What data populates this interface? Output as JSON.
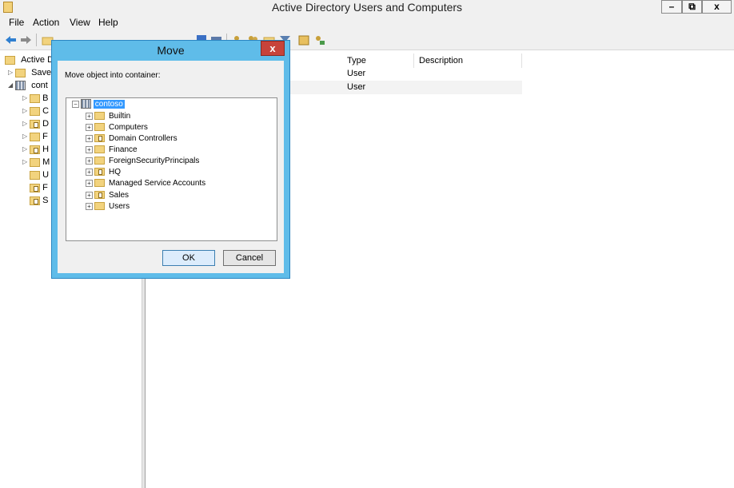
{
  "window": {
    "title": "Active Directory Users and Computers",
    "minimize": "–",
    "restore": "⧉",
    "close": "x"
  },
  "menu": [
    "File",
    "Action",
    "View",
    "Help"
  ],
  "left_tree": {
    "root": "Active D",
    "saved": "Save",
    "domain": "cont",
    "children": [
      "B",
      "C",
      "D",
      "F",
      "H",
      "M",
      "U",
      "F",
      "S"
    ]
  },
  "list": {
    "columns": [
      "Type",
      "Description"
    ],
    "rows": [
      {
        "type": "User",
        "description": ""
      },
      {
        "type": "User",
        "description": ""
      }
    ]
  },
  "dialog": {
    "title": "Move",
    "close": "x",
    "label": "Move object into container:",
    "tree_root": "contoso",
    "containers": [
      {
        "name": "Builtin",
        "ou": false
      },
      {
        "name": "Computers",
        "ou": false
      },
      {
        "name": "Domain Controllers",
        "ou": true
      },
      {
        "name": "Finance",
        "ou": false
      },
      {
        "name": "ForeignSecurityPrincipals",
        "ou": false
      },
      {
        "name": "HQ",
        "ou": true
      },
      {
        "name": "Managed Service Accounts",
        "ou": false
      },
      {
        "name": "Sales",
        "ou": true
      },
      {
        "name": "Users",
        "ou": false
      }
    ],
    "ok": "OK",
    "cancel": "Cancel"
  }
}
